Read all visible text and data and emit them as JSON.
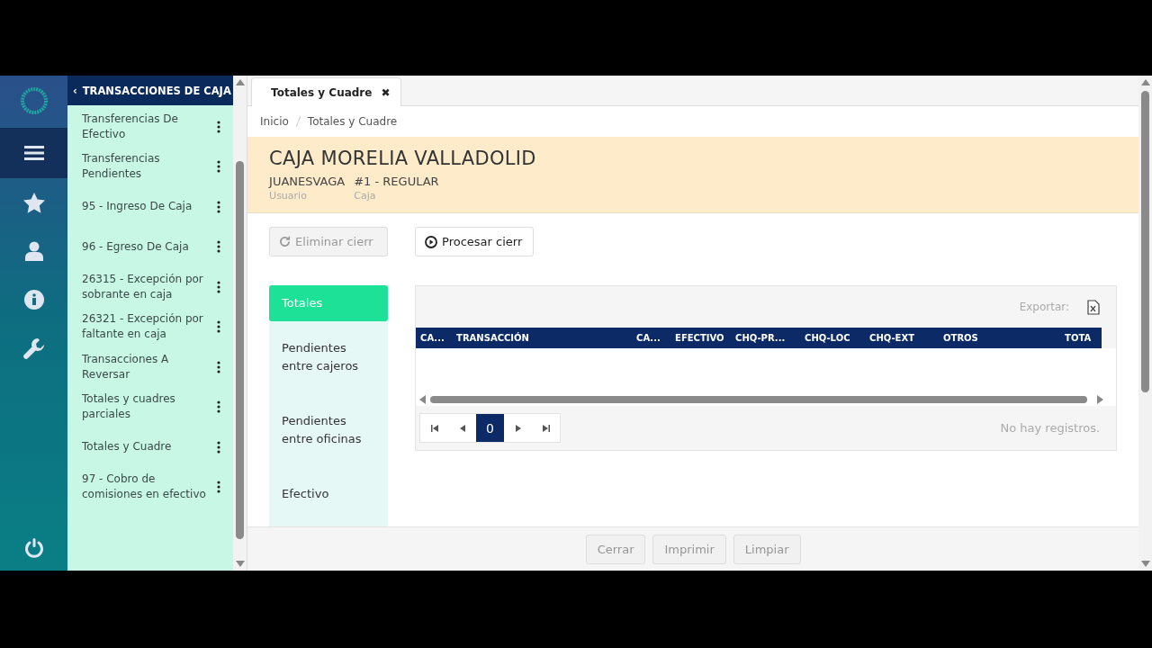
{
  "rail": {
    "items": [
      {
        "kind": "menu",
        "selected": true
      },
      {
        "kind": "star",
        "selected": false
      },
      {
        "kind": "user",
        "selected": false
      },
      {
        "kind": "info",
        "selected": false
      },
      {
        "kind": "wrench",
        "selected": false
      }
    ]
  },
  "submenu": {
    "back": "‹",
    "title": "TRANSACCIONES DE CAJA",
    "items": [
      {
        "label": "Transferencias De Efectivo"
      },
      {
        "label": "Transferencias Pendientes"
      },
      {
        "label": "95 - Ingreso De Caja"
      },
      {
        "label": "96 - Egreso De Caja"
      },
      {
        "label": "26315 - Excepción por sobrante en caja"
      },
      {
        "label": "26321 - Excepción por faltante en caja"
      },
      {
        "label": "Transacciones A Reversar"
      },
      {
        "label": "Totales y cuadres parciales"
      },
      {
        "label": "Totales y Cuadre"
      },
      {
        "label": "97 - Cobro de comisiones en efectivo"
      }
    ]
  },
  "tabs": [
    {
      "label": "Totales y Cuadre",
      "selected": true,
      "close": "✖"
    }
  ],
  "breadcrumb": [
    "Inicio",
    "Totales y Cuadre"
  ],
  "header": {
    "title": "CAJA MORELIA VALLADOLID",
    "fields": [
      {
        "value": "JUANESVAGA",
        "label": "Usuario"
      },
      {
        "value": "#1 - REGULAR",
        "label": "Caja"
      }
    ]
  },
  "actions": [
    {
      "label": "Eliminar cierr",
      "kind": "reload",
      "disabled": true
    },
    {
      "label": "Procesar cierr",
      "kind": "play",
      "disabled": false
    }
  ],
  "sections": [
    {
      "label": "Totales",
      "selected": true
    },
    {
      "label": "Pendientes entre cajeros",
      "selected": false
    },
    {
      "label": "Pendientes entre oficinas",
      "selected": false
    },
    {
      "label": "Efectivo",
      "selected": false
    }
  ],
  "grid": {
    "export_label": "Exportar:",
    "columns": [
      "CA...",
      "TRANSACCIÓN",
      "CA...",
      "EFECTIVO",
      "CHQ-PR...",
      "CHQ-LOC",
      "CHQ-EXT",
      "OTROS",
      "TOTA"
    ],
    "pages": [
      {
        "label": "0",
        "selected": true
      }
    ],
    "empty": "No hay registros."
  },
  "footer_buttons": [
    {
      "label": "Cerrar",
      "disabled": true
    },
    {
      "label": "Imprimir",
      "disabled": true
    },
    {
      "label": "Limpiar",
      "disabled": true
    }
  ]
}
